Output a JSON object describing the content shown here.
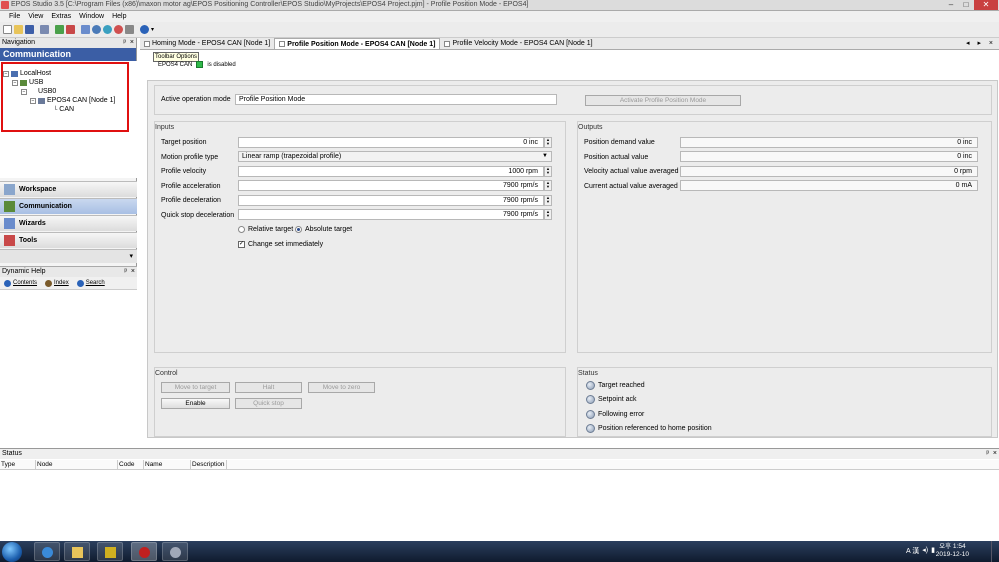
{
  "window": {
    "title": "EPOS Studio 3.5 [C:\\Program Files (x86)\\maxon motor ag\\EPOS Positioning Controller\\EPOS Studio\\MyProjects\\EPOS4 Project.pjm] - Profile Position Mode - EPOS4]"
  },
  "menu": {
    "items": [
      "File",
      "View",
      "Extras",
      "Window",
      "Help"
    ]
  },
  "navigation": {
    "panel_title": "Navigation",
    "header": "Communication",
    "tree": {
      "localhost": "LocalHost",
      "usb": "USB",
      "usb0": "USB0",
      "node": "EPOS4 CAN [Node 1]",
      "can": "CAN"
    },
    "buttons": [
      "Workspace",
      "Communication",
      "Wizards",
      "Tools"
    ]
  },
  "dynamic_help": {
    "title": "Dynamic Help",
    "contents": "Contents",
    "index": "Index",
    "search": "Search"
  },
  "tabs": [
    "Homing Mode - EPOS4 CAN [Node 1]",
    "Profile Position Mode - EPOS4 CAN [Node 1]",
    "Profile Velocity Mode - EPOS4 CAN [Node 1]"
  ],
  "tab_nav": "◂ ▸ ×",
  "toolbar_options_tooltip": "Toolbar Options",
  "device": {
    "name": "EPOS4 CAN",
    "state": "is disabled"
  },
  "operation": {
    "label": "Active operation mode",
    "value": "Profile Position Mode",
    "activate_button": "Activate Profile Position Mode"
  },
  "inputs": {
    "title": "Inputs",
    "target_position": {
      "label": "Target position",
      "value": "0 inc"
    },
    "motion_profile_type": {
      "label": "Motion profile type",
      "value": "Linear ramp (trapezoidal profile)"
    },
    "profile_velocity": {
      "label": "Profile velocity",
      "value": "1000 rpm"
    },
    "profile_acceleration": {
      "label": "Profile acceleration",
      "value": "7900 rpm/s"
    },
    "profile_deceleration": {
      "label": "Profile deceleration",
      "value": "7900 rpm/s"
    },
    "quick_stop_deceleration": {
      "label": "Quick stop deceleration",
      "value": "7900 rpm/s"
    },
    "relative_target": "Relative target",
    "absolute_target": "Absolute target",
    "change_set_immediately": "Change set immediately"
  },
  "outputs": {
    "title": "Outputs",
    "position_demand": {
      "label": "Position demand value",
      "value": "0 inc"
    },
    "position_actual": {
      "label": "Position actual value",
      "value": "0 inc"
    },
    "velocity_actual": {
      "label": "Velocity actual value averaged",
      "value": "0 rpm"
    },
    "current_actual": {
      "label": "Current actual value averaged",
      "value": "0 mA"
    }
  },
  "control": {
    "title": "Control",
    "move_to_target": "Move to target",
    "halt": "Halt",
    "move_to_zero": "Move to zero",
    "enable": "Enable",
    "quick_stop": "Quick stop"
  },
  "status_group": {
    "title": "Status",
    "items": [
      "Target reached",
      "Setpoint ack",
      "Following error",
      "Position referenced to home position"
    ]
  },
  "status_panel": {
    "title": "Status",
    "columns": [
      "Type",
      "Node",
      "Code",
      "Name",
      "Description"
    ]
  },
  "taskbar": {
    "time": "오후 1:54",
    "date": "2019-12-10",
    "tray": "A 漢"
  },
  "colors": {
    "nav_header": "#3b5ea5",
    "highlight_box": "#e01010",
    "device_enabled_led": "#2fb94a"
  }
}
